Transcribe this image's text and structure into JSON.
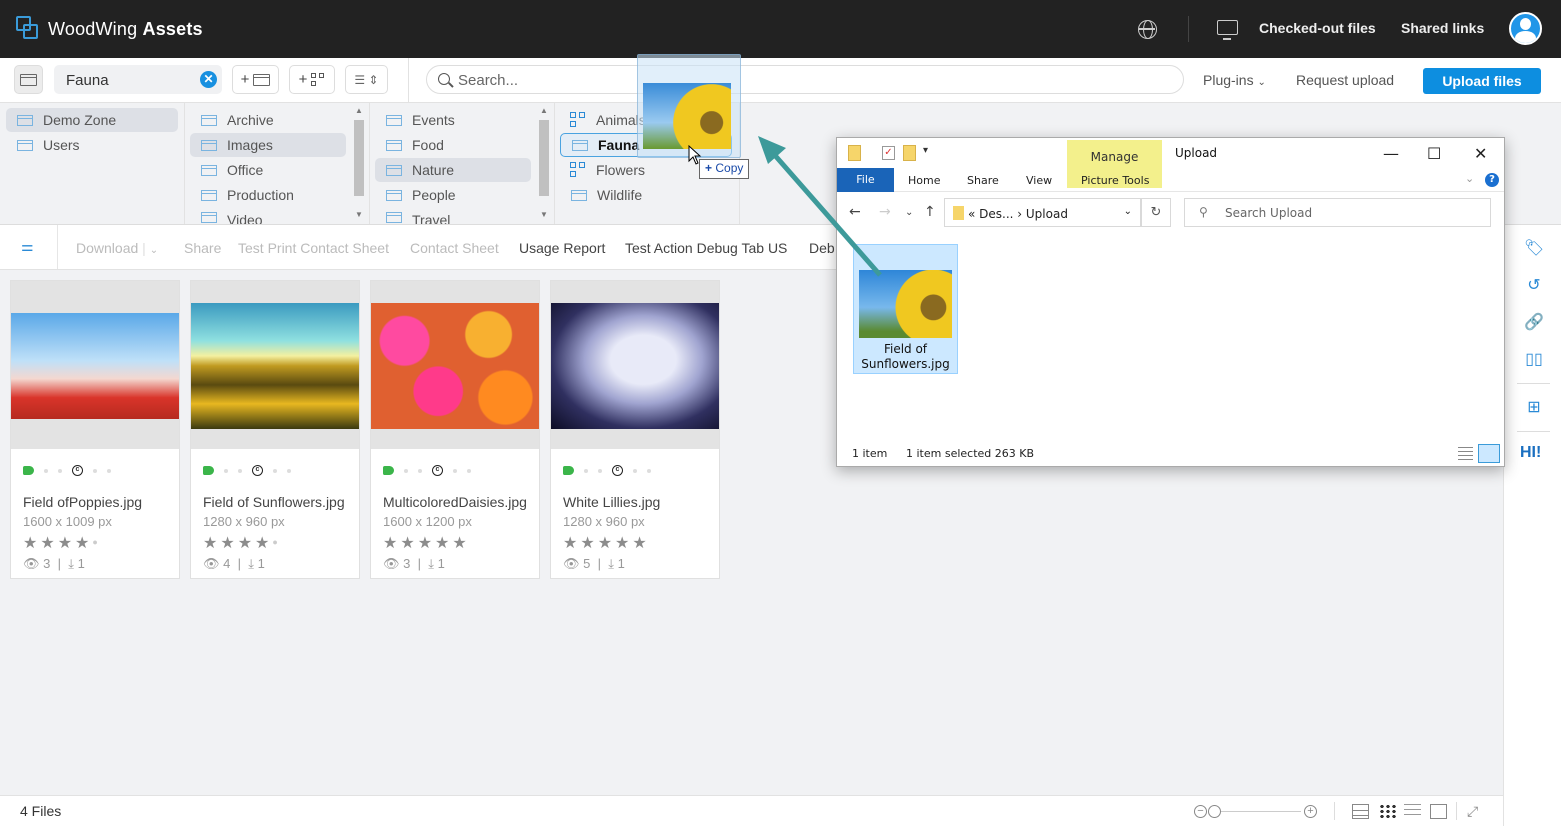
{
  "app": {
    "brand_light": "WoodWing",
    "brand_bold": "Assets"
  },
  "topbar": {
    "checked_out": "Checked-out files",
    "shared_links": "Shared links",
    "icons": [
      "globe-icon",
      "monitor-check-icon",
      "user-avatar-icon"
    ]
  },
  "toolbar": {
    "breadcrumb": "Fauna",
    "add_folder": "+",
    "add_collection": "+",
    "search_placeholder": "Search...",
    "plugins": "Plug-ins",
    "request_upload": "Request upload",
    "upload_files": "Upload files"
  },
  "browser": {
    "col1": [
      {
        "label": "Demo Zone",
        "selected": true
      },
      {
        "label": "Users",
        "selected": false
      }
    ],
    "col2": [
      {
        "label": "Archive"
      },
      {
        "label": "Images",
        "selected": true
      },
      {
        "label": "Office"
      },
      {
        "label": "Production"
      },
      {
        "label": "Video"
      }
    ],
    "col3": [
      {
        "label": "Events"
      },
      {
        "label": "Food"
      },
      {
        "label": "Nature",
        "selected": true
      },
      {
        "label": "People"
      },
      {
        "label": "Travel"
      }
    ],
    "col4": [
      {
        "label": "Animals",
        "type": "collection"
      },
      {
        "label": "Fauna",
        "type": "folder",
        "drop_target": true
      },
      {
        "label": "Flowers",
        "type": "collection"
      },
      {
        "label": "Wildlife",
        "type": "folder"
      }
    ]
  },
  "actions": {
    "download": "Download",
    "share": "Share",
    "test_print": "Test Print Contact Sheet",
    "contact_sheet": "Contact Sheet",
    "usage_report": "Usage Report",
    "test_action": "Test Action Debug Tab US",
    "debug": "Deb"
  },
  "assets": [
    {
      "name": "Field ofPoppies.jpg",
      "dims": "1600 x 1009 px",
      "rating": 4,
      "views": "3",
      "downloads": "1"
    },
    {
      "name": "Field of Sunflowers.jpg",
      "dims": "1280 x 960 px",
      "rating": 4,
      "views": "4",
      "downloads": "1"
    },
    {
      "name": "MulticoloredDaisies.jpg",
      "dims": "1600 x 1200 px",
      "rating": 5,
      "views": "3",
      "downloads": "1"
    },
    {
      "name": "White Lillies.jpg",
      "dims": "1280 x 960 px",
      "rating": 5,
      "views": "5",
      "downloads": "1"
    }
  ],
  "status": {
    "count": "4 Files"
  },
  "drag": {
    "tooltip": "Copy"
  },
  "explorer": {
    "title": "Upload",
    "manage": "Manage",
    "tabs": {
      "file": "File",
      "home": "Home",
      "share": "Share",
      "view": "View",
      "picture_tools": "Picture Tools"
    },
    "address": "« Des...  ›  Upload",
    "search_placeholder": "Search Upload",
    "file_name": "Field of Sunflowers.jpg",
    "status_items": "1 item",
    "status_selected": "1 item selected  263 KB"
  },
  "right_panel": {
    "icons": [
      "tag-icon",
      "history-icon",
      "attachment-icon",
      "compare-icon",
      "add-to-collection-icon",
      "hi-icon"
    ],
    "hi_label": "HI!"
  },
  "colors": {
    "accent": "#0d8ee0",
    "tag_green": "#3bb54a",
    "arrow": "#3d9a9a",
    "manage": "#f3f08c"
  }
}
